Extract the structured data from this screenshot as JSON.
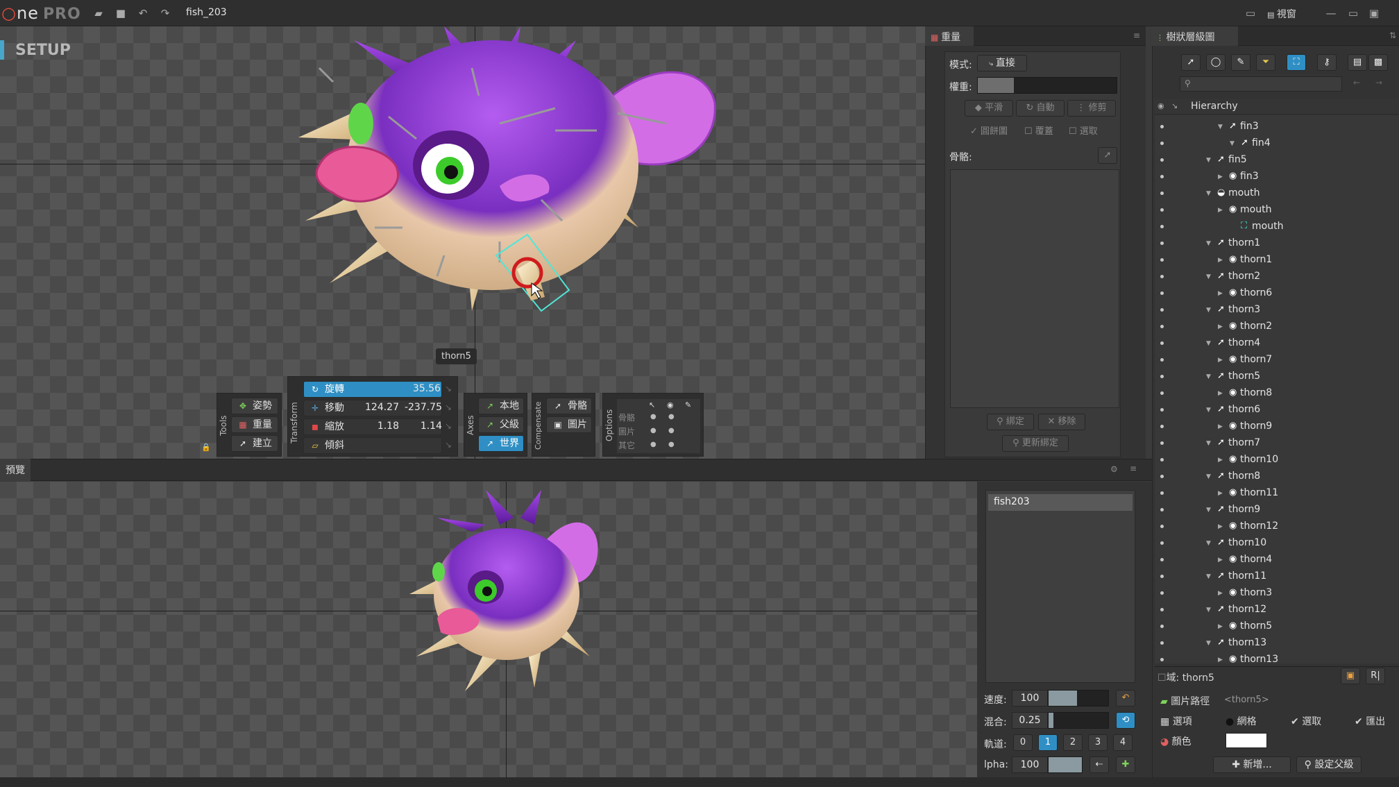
{
  "app": {
    "logo": "ne",
    "edition": "PRO",
    "file_name": "fish_203",
    "view_menu": "視窗"
  },
  "colors": {
    "accent": "#2f8fc4",
    "panel": "#333333",
    "bone_select": "#4fe6d6",
    "rotate_marker": "#d01c1c"
  },
  "viewport": {
    "mode_label": "SETUP",
    "selected_bone_tag": "thorn5"
  },
  "tools": {
    "group_label": "Tools",
    "pose": "姿勢",
    "weights": "重量",
    "create": "建立"
  },
  "transform": {
    "group_label": "Transform",
    "rotate": {
      "label": "旋轉",
      "value": "35.56"
    },
    "translate": {
      "label": "移動",
      "x": "124.27",
      "y": "-237.75"
    },
    "scale": {
      "label": "縮放",
      "x": "1.18",
      "y": "1.14"
    },
    "shear": {
      "label": "傾斜"
    }
  },
  "axes": {
    "group_label": "Axes",
    "local": "本地",
    "parent": "父級",
    "world": "世界"
  },
  "compensate": {
    "group_label": "Compensate",
    "bones": "骨骼",
    "images": "圖片"
  },
  "options": {
    "group_label": "Options",
    "rows": [
      "骨骼",
      "圖片",
      "其它"
    ]
  },
  "preview": {
    "tab": "預覽",
    "animations": [
      "fish203"
    ],
    "speed_label": "速度:",
    "speed_value": "100",
    "speed_fraction": 0.48,
    "mix_label": "混合:",
    "mix_value": "0.25",
    "mix_fraction": 0.08,
    "track_label": "軌道:",
    "tracks": [
      "0",
      "1",
      "2",
      "3",
      "4"
    ],
    "track_selected": "1",
    "alpha_label": "lpha:",
    "alpha_value": "100",
    "alpha_fraction": 1.0
  },
  "weights_panel": {
    "tab": "重量",
    "mode_label": "模式:",
    "mode_value": "直接",
    "weight_label": "權重:",
    "smooth": "平滑",
    "auto": "自動",
    "prune": "修剪",
    "overlay": "圓餅圖",
    "cover": "覆蓋",
    "select": "選取",
    "bones_label": "骨骼:",
    "bind": "綁定",
    "remove": "移除",
    "update_binding": "更新綁定"
  },
  "tree_panel": {
    "tab": "樹狀層級圖",
    "search_placeholder": "",
    "header": "Hierarchy",
    "rows": [
      {
        "label": "fin3",
        "type": "bone",
        "indent": 3
      },
      {
        "label": "fin4",
        "type": "bone",
        "indent": 4
      },
      {
        "label": "fin5",
        "type": "bone",
        "indent": 2
      },
      {
        "label": "fin3",
        "type": "slot",
        "indent": 3
      },
      {
        "label": "mouth",
        "type": "slot-eye",
        "indent": 2
      },
      {
        "label": "mouth",
        "type": "slot",
        "indent": 3
      },
      {
        "label": "mouth",
        "type": "mesh",
        "indent": 4
      },
      {
        "label": "thorn1",
        "type": "bone",
        "indent": 2
      },
      {
        "label": "thorn1",
        "type": "slot",
        "indent": 3
      },
      {
        "label": "thorn2",
        "type": "bone",
        "indent": 2
      },
      {
        "label": "thorn6",
        "type": "slot",
        "indent": 3
      },
      {
        "label": "thorn3",
        "type": "bone",
        "indent": 2
      },
      {
        "label": "thorn2",
        "type": "slot",
        "indent": 3
      },
      {
        "label": "thorn4",
        "type": "bone",
        "indent": 2
      },
      {
        "label": "thorn7",
        "type": "slot",
        "indent": 3
      },
      {
        "label": "thorn5",
        "type": "bone",
        "indent": 2
      },
      {
        "label": "thorn8",
        "type": "slot",
        "indent": 3
      },
      {
        "label": "thorn6",
        "type": "bone",
        "indent": 2
      },
      {
        "label": "thorn9",
        "type": "slot",
        "indent": 3
      },
      {
        "label": "thorn7",
        "type": "bone",
        "indent": 2
      },
      {
        "label": "thorn10",
        "type": "slot",
        "indent": 3
      },
      {
        "label": "thorn8",
        "type": "bone",
        "indent": 2
      },
      {
        "label": "thorn11",
        "type": "slot",
        "indent": 3
      },
      {
        "label": "thorn9",
        "type": "bone",
        "indent": 2
      },
      {
        "label": "thorn12",
        "type": "slot",
        "indent": 3
      },
      {
        "label": "thorn10",
        "type": "bone",
        "indent": 2
      },
      {
        "label": "thorn4",
        "type": "slot",
        "indent": 3
      },
      {
        "label": "thorn11",
        "type": "bone",
        "indent": 2
      },
      {
        "label": "thorn3",
        "type": "slot",
        "indent": 3
      },
      {
        "label": "thorn12",
        "type": "bone",
        "indent": 2
      },
      {
        "label": "thorn5",
        "type": "slot",
        "indent": 3
      },
      {
        "label": "thorn13",
        "type": "bone",
        "indent": 2
      },
      {
        "label": "thorn13",
        "type": "slot",
        "indent": 3
      }
    ]
  },
  "props": {
    "title": "域: thorn5",
    "image_path_label": "圖片路徑",
    "image_path_value": "<thorn5>",
    "options_label": "選項",
    "mesh": "網格",
    "select": "選取",
    "export": "匯出",
    "color_label": "顏色",
    "new": "新增...",
    "set_parent": "設定父級"
  }
}
